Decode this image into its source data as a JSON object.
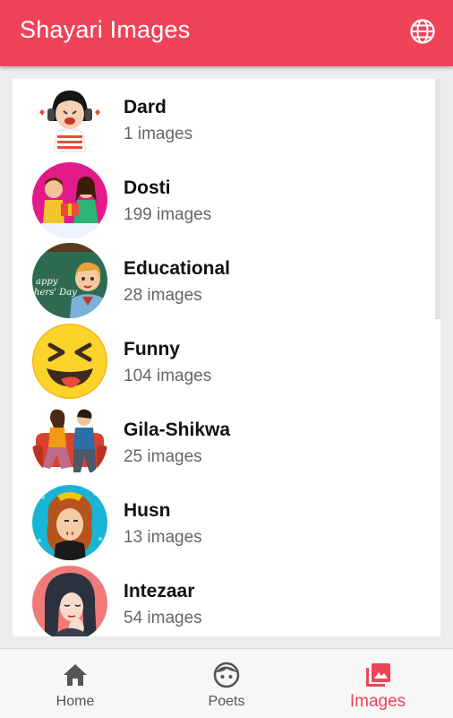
{
  "app": {
    "title": "Shayari Images",
    "accent": "#f0435a"
  },
  "header": {
    "language_icon": "globe-icon"
  },
  "categories": [
    {
      "name": "Dard",
      "count": "1 images"
    },
    {
      "name": "Dosti",
      "count": "199 images"
    },
    {
      "name": "Educational",
      "count": "28 images"
    },
    {
      "name": "Funny",
      "count": "104 images"
    },
    {
      "name": "Gila-Shikwa",
      "count": "25 images"
    },
    {
      "name": "Husn",
      "count": "13 images"
    },
    {
      "name": "Intezaar",
      "count": "54 images"
    }
  ],
  "bottom_nav": {
    "items": [
      {
        "label": "Home",
        "icon": "home-icon"
      },
      {
        "label": "Poets",
        "icon": "face-icon"
      },
      {
        "label": "Images",
        "icon": "photo-library-icon"
      }
    ],
    "active": "Images"
  }
}
